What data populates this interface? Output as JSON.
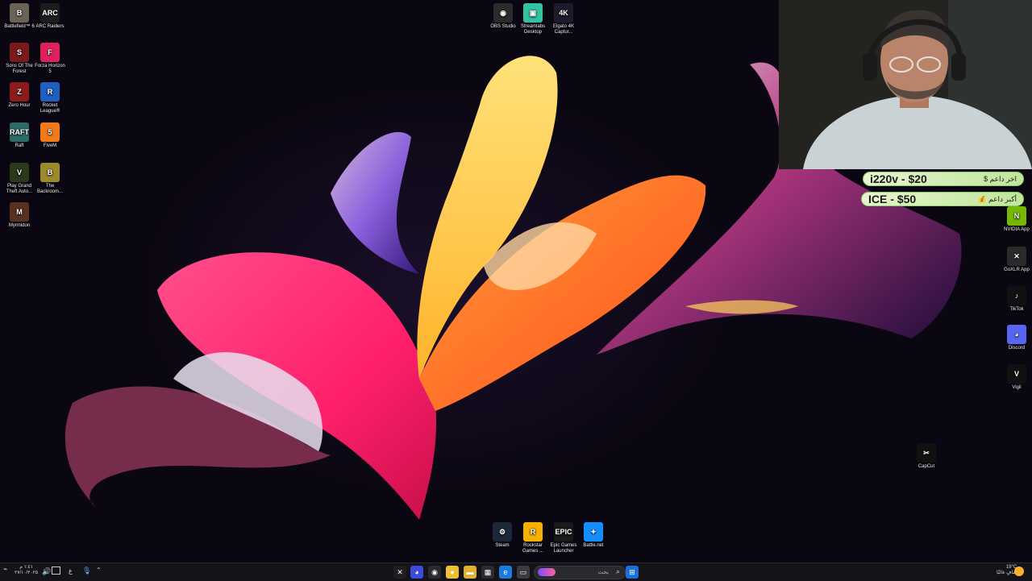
{
  "desktop": {
    "left_icons": [
      {
        "label": "Battlefield™ 6",
        "color": "#6b6256",
        "glyph": "B"
      },
      {
        "label": "ARC Raiders",
        "color": "#1c1c1c",
        "glyph": "ARC"
      },
      {
        "label": "Sons Of The Forest",
        "color": "#7a1a1a",
        "glyph": "S"
      },
      {
        "label": "Forza Horizon 5",
        "color": "#e0205c",
        "glyph": "F"
      },
      {
        "label": "Zero Hour",
        "color": "#8a1c1c",
        "glyph": "Z"
      },
      {
        "label": "Rocket League®",
        "color": "#1e5fbf",
        "glyph": "R"
      },
      {
        "label": "Raft",
        "color": "#2f6a6a",
        "glyph": "RAFT"
      },
      {
        "label": "FiveM",
        "color": "#f07a1a",
        "glyph": "5"
      },
      {
        "label": "Play Grand Theft Auto...",
        "color": "#2a3a1a",
        "glyph": "V"
      },
      {
        "label": "The Backroom...",
        "color": "#9a8a2a",
        "glyph": "B"
      },
      {
        "label": "Myrmidon",
        "color": "#5a3020",
        "glyph": "M"
      }
    ],
    "top_icons": [
      {
        "label": "OBS Studio",
        "color": "#2b2b2b",
        "glyph": "◉"
      },
      {
        "label": "Streamlabs Desktop",
        "color": "#31c3a2",
        "glyph": "▣"
      },
      {
        "label": "Elgato 4K Captur...",
        "color": "#1b1b2b",
        "glyph": "4K"
      }
    ],
    "right_icons": [
      {
        "label": "NVIDIA App",
        "color": "#76b900",
        "glyph": "N"
      },
      {
        "label": "GoXLR App",
        "color": "#2b2b2b",
        "glyph": "✕"
      },
      {
        "label": "TikTok",
        "color": "#111111",
        "glyph": "♪"
      },
      {
        "label": "Discord",
        "color": "#5865f2",
        "glyph": "◕"
      },
      {
        "label": "Vigil",
        "color": "#111111",
        "glyph": "V"
      },
      {
        "label": "CapCut",
        "color": "#111111",
        "glyph": "✂"
      }
    ],
    "bottom_icons": [
      {
        "label": "Steam",
        "color": "#1b2838",
        "glyph": "⚙"
      },
      {
        "label": "Rockstar Games ...",
        "color": "#f5b000",
        "glyph": "R"
      },
      {
        "label": "Epic Games Launcher",
        "color": "#1a1a1a",
        "glyph": "EPIC"
      },
      {
        "label": "Battle.net",
        "color": "#148eff",
        "glyph": "✦"
      }
    ]
  },
  "overlay": {
    "donations": [
      {
        "text": "i220v - $20",
        "label_ar": "$ اخر داعم"
      },
      {
        "text": "ICE - $50",
        "label_ar": "💰 أكبر داعم"
      }
    ]
  },
  "taskbar": {
    "search_placeholder": "بحث",
    "left_time": "١:٤١ م",
    "left_date": "٢٧/١٠/٢٠٢٥",
    "lang": "ع",
    "weather": "19°C",
    "weather_desc": "صافٍ غالبًا"
  }
}
